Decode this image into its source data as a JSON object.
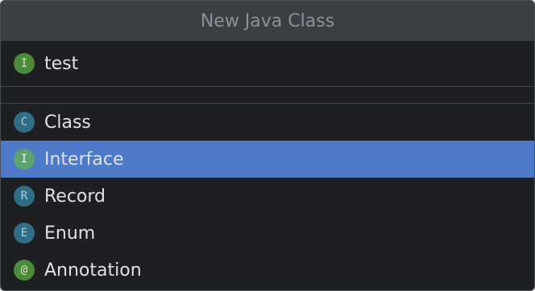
{
  "dialog": {
    "title": "New Java Class"
  },
  "name_field": {
    "icon_letter": "I",
    "value": "test"
  },
  "kinds": [
    {
      "icon_letter": "C",
      "label": "Class",
      "icon": "class-icon"
    },
    {
      "icon_letter": "I",
      "label": "Interface",
      "icon": "interface-icon",
      "selected": true
    },
    {
      "icon_letter": "R",
      "label": "Record",
      "icon": "record-icon"
    },
    {
      "icon_letter": "E",
      "label": "Enum",
      "icon": "enum-icon"
    },
    {
      "icon_letter": "@",
      "label": "Annotation",
      "icon": "annotation-icon"
    }
  ],
  "colors": {
    "selection": "#4f79c9",
    "background": "#1e1f22",
    "title_bar": "#3b3e42"
  }
}
